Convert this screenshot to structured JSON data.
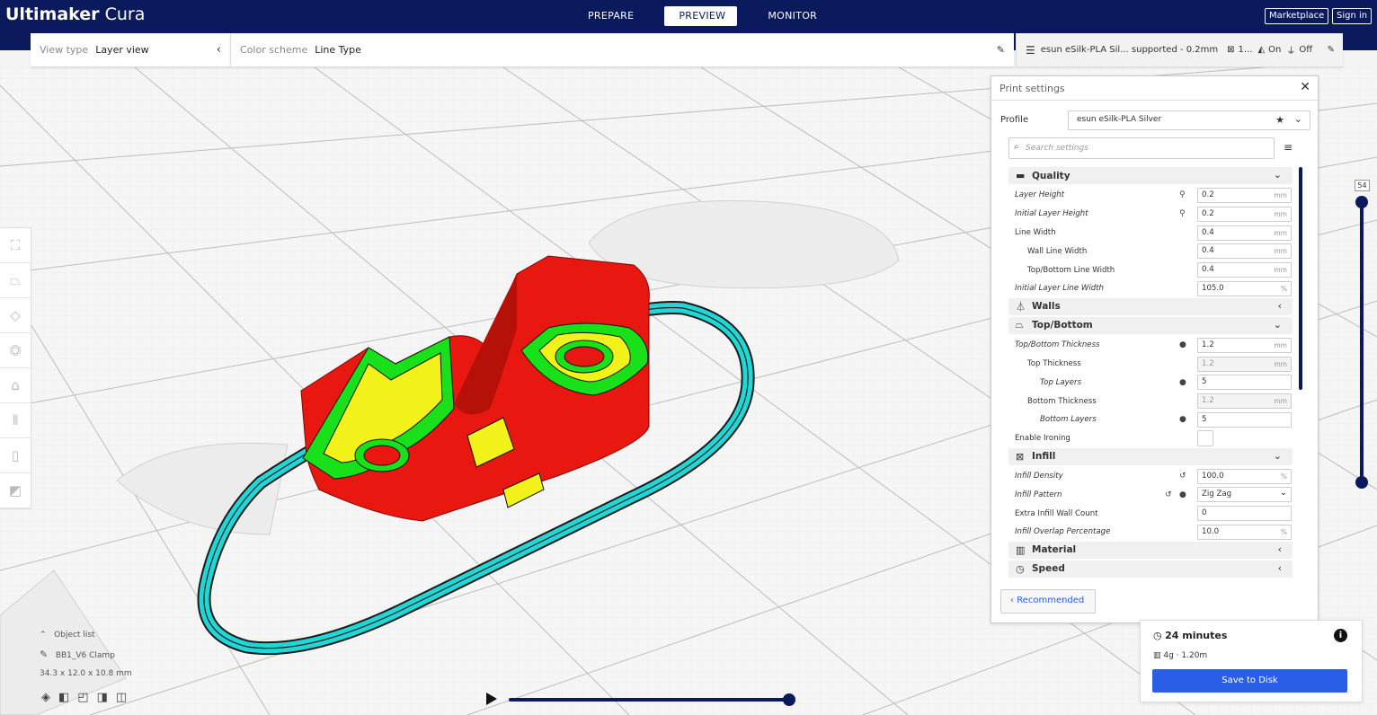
{
  "app": {
    "name_bold": "Ultimaker",
    "name_rest": " Cura"
  },
  "stages": [
    "PREPARE",
    "PREVIEW",
    "MONITOR"
  ],
  "header_buttons": {
    "marketplace": "Marketplace",
    "signin": "Sign in"
  },
  "view": {
    "type_label": "View type",
    "type_value": "Layer view",
    "scheme_label": "Color scheme",
    "scheme_value": "Line Type"
  },
  "printer": {
    "profile": "esun eSilk-PLA Sil... supported - 0.2mm",
    "infill": "1...",
    "support": "On",
    "adhesion": "Off"
  },
  "panel": {
    "title": "Print settings",
    "profile_label": "Profile",
    "profile_value": "esun eSilk-PLA Silver",
    "search_placeholder": "Search settings",
    "recommended": "Recommended",
    "categories": {
      "quality": "Quality",
      "walls": "Walls",
      "topbottom": "Top/Bottom",
      "infill": "Infill",
      "material": "Material",
      "speed": "Speed"
    },
    "settings": {
      "layer_height": {
        "label": "Layer Height",
        "value": "0.2",
        "unit": "mm"
      },
      "initial_layer_height": {
        "label": "Initial Layer Height",
        "value": "0.2",
        "unit": "mm"
      },
      "line_width": {
        "label": "Line Width",
        "value": "0.4",
        "unit": "mm"
      },
      "wall_line_width": {
        "label": "Wall Line Width",
        "value": "0.4",
        "unit": "mm"
      },
      "tb_line_width": {
        "label": "Top/Bottom Line Width",
        "value": "0.4",
        "unit": "mm"
      },
      "initial_layer_line_width": {
        "label": "Initial Layer Line Width",
        "value": "105.0",
        "unit": "%"
      },
      "tb_thickness": {
        "label": "Top/Bottom Thickness",
        "value": "1.2",
        "unit": "mm"
      },
      "top_thickness": {
        "label": "Top Thickness",
        "value": "1.2",
        "unit": "mm"
      },
      "top_layers": {
        "label": "Top Layers",
        "value": "5"
      },
      "bottom_thickness": {
        "label": "Bottom Thickness",
        "value": "1.2",
        "unit": "mm"
      },
      "bottom_layers": {
        "label": "Bottom Layers",
        "value": "5"
      },
      "enable_ironing": {
        "label": "Enable Ironing"
      },
      "infill_density": {
        "label": "Infill Density",
        "value": "100.0",
        "unit": "%"
      },
      "infill_pattern": {
        "label": "Infill Pattern",
        "value": "Zig Zag"
      },
      "extra_infill_wall": {
        "label": "Extra Infill Wall Count",
        "value": "0"
      },
      "infill_overlap": {
        "label": "Infill Overlap Percentage",
        "value": "10.0",
        "unit": "%"
      }
    }
  },
  "layer_slider": {
    "top_label": "54"
  },
  "object": {
    "list_label": "Object list",
    "name": "BB1_V6 Clamp",
    "dims": "34.3 x 12.0 x 10.8 mm"
  },
  "output": {
    "time": "24 minutes",
    "material": "4g · 1.20m",
    "save": "Save to Disk"
  },
  "colors": {
    "header": "#0b1a5c",
    "accent": "#2b5ee6",
    "part_red": "#e8170f",
    "top_green": "#19e119",
    "top_yellow": "#f2f21a",
    "skirt_cyan": "#22d6d6"
  }
}
